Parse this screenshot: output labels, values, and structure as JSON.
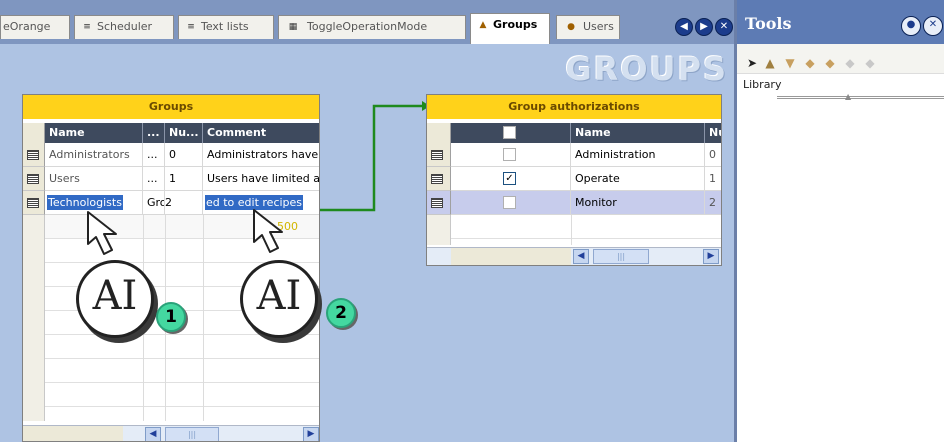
{
  "tabs": [
    {
      "label": "eOrange",
      "icon": ""
    },
    {
      "label": "Scheduler",
      "icon": "scheduler-icon"
    },
    {
      "label": "Text lists",
      "icon": "text-lists-icon"
    },
    {
      "label": "ToggleOperationMode",
      "icon": "script-icon"
    },
    {
      "label": "Groups",
      "icon": "groups-icon",
      "active": true
    },
    {
      "label": "Users",
      "icon": "users-icon"
    }
  ],
  "watermark": "GROUPS",
  "groups_grid": {
    "title": "Groups",
    "columns": [
      "Name",
      "...",
      "Nu...",
      "Comment"
    ],
    "rows": [
      {
        "name": "Administrators",
        "display": "...",
        "number": "0",
        "comment": "Administrators have"
      },
      {
        "name": "Users",
        "display": "...",
        "number": "1",
        "comment": "Users have limited a"
      },
      {
        "name": "Technologists",
        "display": "Gro",
        "number": "2",
        "comment": "ed to edit recipes"
      }
    ],
    "extra_value": "500"
  },
  "auth_grid": {
    "title": "Group authorizations",
    "columns": [
      "",
      "Name",
      "Nu"
    ],
    "rows": [
      {
        "checked": false,
        "name": "Administration",
        "number": "0"
      },
      {
        "checked": true,
        "name": "Operate",
        "number": "1"
      },
      {
        "checked": false,
        "name": "Monitor",
        "number": "2"
      }
    ]
  },
  "tools": {
    "title": "Tools",
    "library_label": "Library"
  },
  "callouts": [
    {
      "text": "AI",
      "badge": "1"
    },
    {
      "text": "AI",
      "badge": "2"
    }
  ],
  "colors": {
    "header_yellow": "#ffd21a",
    "selection_blue": "#316ac5",
    "editor_bg": "#aec3e3",
    "arrow_green": "#1e8a1e",
    "badge_green": "#44d8a0"
  }
}
